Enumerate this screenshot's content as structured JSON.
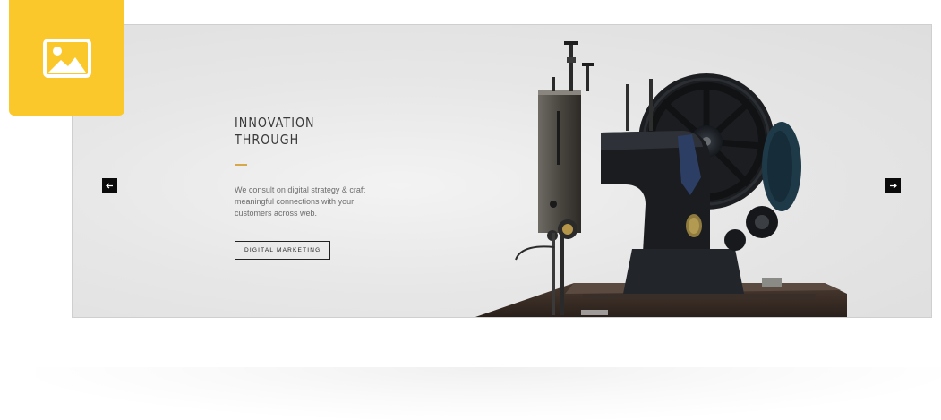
{
  "badge": {
    "icon": "image-icon",
    "color": "#fbc82b"
  },
  "slide": {
    "title_line1": "INNOVATION",
    "title_line2": "THROUGH",
    "description": "We consult on digital strategy & craft meaningful connections with your customers across web.",
    "button_label": "DIGITAL MARKETING",
    "accent_color": "#d6a84a",
    "image": "sewing-machine"
  },
  "navigation": {
    "prev_icon": "arrow-left-icon",
    "next_icon": "arrow-right-icon"
  }
}
